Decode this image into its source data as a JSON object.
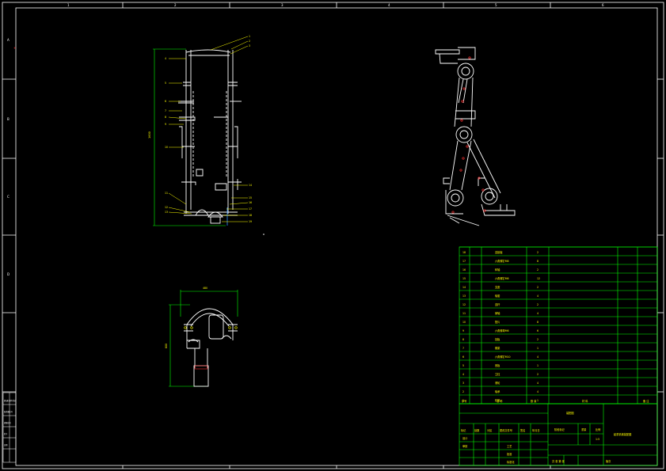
{
  "colors": {
    "background": "#000000",
    "frame": "#ffffff",
    "geometry": "#ffffff",
    "dimension": "#00ff00",
    "leader": "#ffff00",
    "table": "#00ff00",
    "text": "#ffff00",
    "hidden": "#ff3030"
  },
  "border_marks": {
    "top": [
      "1",
      "2",
      "3",
      "4",
      "5",
      "6"
    ],
    "left": [
      "A",
      "B",
      "C",
      "D"
    ]
  },
  "front_view": {
    "height_dim": "1600",
    "balloons": [
      "1",
      "2",
      "3",
      "4",
      "5",
      "6",
      "7",
      "8",
      "9",
      "10",
      "11",
      "12",
      "13",
      "14",
      "15",
      "16",
      "17",
      "18",
      "19"
    ]
  },
  "top_view": {
    "width_dim": "480",
    "height_dim": "600"
  },
  "parts_list": {
    "rows": [
      {
        "no": "18",
        "name": "连接板",
        "qty": "2"
      },
      {
        "no": "17",
        "name": "六角螺钉M8",
        "qty": "8"
      },
      {
        "no": "16",
        "name": "转轴",
        "qty": "2"
      },
      {
        "no": "15",
        "name": "六角螺钉M6",
        "qty": "12"
      },
      {
        "no": "14",
        "name": "支座",
        "qty": "2"
      },
      {
        "no": "13",
        "name": "轴套",
        "qty": "4"
      },
      {
        "no": "12",
        "name": "连杆",
        "qty": "2"
      },
      {
        "no": "11",
        "name": "销轴",
        "qty": "4"
      },
      {
        "no": "10",
        "name": "垫片",
        "qty": "8"
      },
      {
        "no": "9",
        "name": "六角螺母M6",
        "qty": "6"
      },
      {
        "no": "8",
        "name": "挡板",
        "qty": "2"
      },
      {
        "no": "7",
        "name": "横梁",
        "qty": "1"
      },
      {
        "no": "6",
        "name": "六角螺钉M10",
        "qty": "4"
      },
      {
        "no": "5",
        "name": "底板",
        "qty": "1"
      },
      {
        "no": "4",
        "name": "立柱",
        "qty": "2"
      },
      {
        "no": "3",
        "name": "滚轮",
        "qty": "4"
      },
      {
        "no": "2",
        "name": "轴承",
        "qty": "4"
      },
      {
        "no": "1",
        "name": "机架",
        "qty": "1"
      }
    ],
    "header": {
      "no": "序号",
      "name": "名 称",
      "qty": "数 量",
      "material": "材 料",
      "remark": "备 注"
    }
  },
  "title_block": {
    "assembly_title": "装配图",
    "drawing_name": "起重机械装配图",
    "stage_label": "阶段标记",
    "weight_label": "重量",
    "scale_label": "比例",
    "scale_value": "1:5",
    "row_labels": [
      "标记",
      "处数",
      "分区",
      "更改文件号",
      "签名",
      "年月日"
    ],
    "design": "设计",
    "check": "审核",
    "process": "工艺",
    "approve": "批准",
    "standard": "标准化",
    "sheets": "共 张 第 张",
    "school": "版次"
  },
  "left_strip": [
    "借(通)用件登记",
    "旧底图总号",
    "底图总号",
    "签字",
    "日期"
  ]
}
